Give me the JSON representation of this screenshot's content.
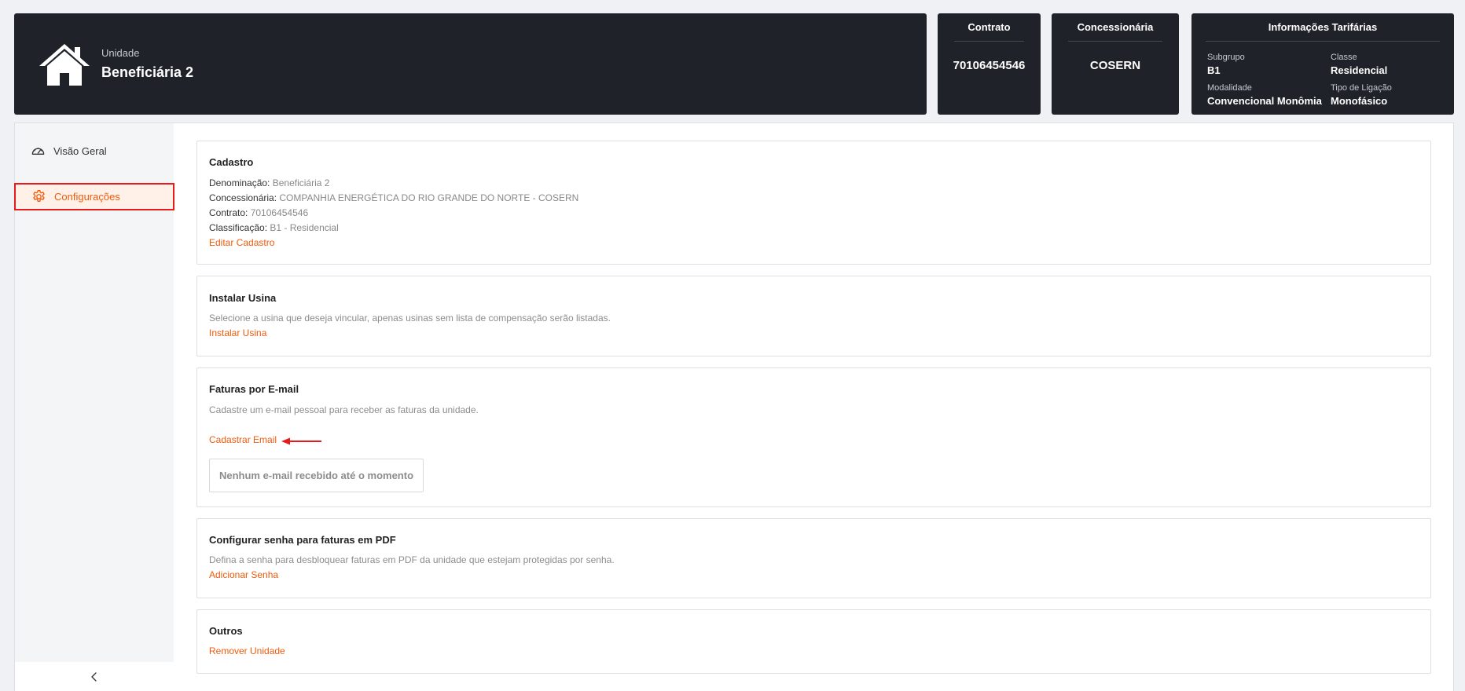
{
  "unit": {
    "label": "Unidade",
    "name": "Beneficiária 2"
  },
  "contract": {
    "title": "Contrato",
    "value": "70106454546"
  },
  "utility": {
    "title": "Concessionária",
    "value": "COSERN"
  },
  "tariff": {
    "title": "Informações Tarifárias",
    "fields": [
      {
        "label": "Subgrupo",
        "value": "B1"
      },
      {
        "label": "Classe",
        "value": "Residencial"
      },
      {
        "label": "Modalidade",
        "value": "Convencional Monômia"
      },
      {
        "label": "Tipo de Ligação",
        "value": "Monofásico"
      }
    ]
  },
  "sidebar": {
    "items": [
      {
        "label": "Visão Geral",
        "icon": "gauge-icon"
      },
      {
        "label": "Configurações",
        "icon": "gear-icon",
        "active": true
      }
    ],
    "collapse_icon": "chevron-left-icon"
  },
  "sections": {
    "cadastro": {
      "title": "Cadastro",
      "fields": [
        {
          "label": "Denominação:",
          "value": "Beneficiária 2"
        },
        {
          "label": "Concessionária:",
          "value": "COMPANHIA ENERGÉTICA DO RIO GRANDE DO NORTE - COSERN"
        },
        {
          "label": "Contrato:",
          "value": "70106454546"
        },
        {
          "label": "Classificação:",
          "value": "B1 - Residencial"
        }
      ],
      "link": "Editar Cadastro"
    },
    "usina": {
      "title": "Instalar Usina",
      "description": "Selecione a usina que deseja vincular, apenas usinas sem lista de compensação serão listadas.",
      "link": "Instalar Usina"
    },
    "email": {
      "title": "Faturas por E-mail",
      "description": "Cadastre um e-mail pessoal para receber as faturas da unidade.",
      "link": "Cadastrar Email",
      "empty_state": "Nenhum e-mail recebido até o momento"
    },
    "senha": {
      "title": "Configurar senha para faturas em PDF",
      "description": "Defina a senha para desbloquear faturas em PDF da unidade que estejam protegidas por senha.",
      "link": "Adicionar Senha"
    },
    "outros": {
      "title": "Outros",
      "link": "Remover Unidade"
    }
  },
  "colors": {
    "accent": "#ef5b0c",
    "header_bg": "#1f2329",
    "highlight": "#e81b1b"
  }
}
